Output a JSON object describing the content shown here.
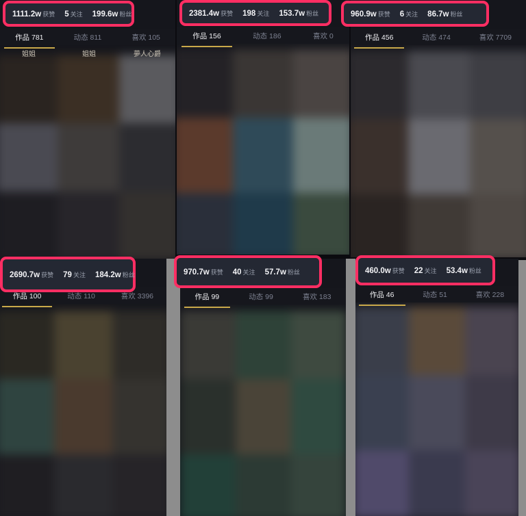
{
  "panels": [
    {
      "id": "p1",
      "stats": [
        {
          "num": "1111.2w",
          "lbl": "获赞"
        },
        {
          "num": "5",
          "lbl": "关注"
        },
        {
          "num": "199.6w",
          "lbl": "粉丝"
        }
      ],
      "tabs": [
        {
          "label": "作品 781",
          "active": true
        },
        {
          "label": "动态 811"
        },
        {
          "label": "喜欢 105"
        }
      ],
      "thumb_titles": [
        "姐姐",
        "姐姐",
        "夢人心爵"
      ]
    },
    {
      "id": "p2",
      "stats": [
        {
          "num": "2381.4w",
          "lbl": "获赞"
        },
        {
          "num": "198",
          "lbl": "关注"
        },
        {
          "num": "153.7w",
          "lbl": "粉丝"
        }
      ],
      "tabs": [
        {
          "label": "作品 156",
          "active": true
        },
        {
          "label": "动态 186"
        },
        {
          "label": "喜欢 0"
        }
      ]
    },
    {
      "id": "p3",
      "stats": [
        {
          "num": "960.9w",
          "lbl": "获赞"
        },
        {
          "num": "6",
          "lbl": "关注"
        },
        {
          "num": "86.7w",
          "lbl": "粉丝"
        }
      ],
      "tabs": [
        {
          "label": "作品 456",
          "active": true
        },
        {
          "label": "动态 474"
        },
        {
          "label": "喜欢 7709"
        }
      ]
    },
    {
      "id": "p4",
      "stats": [
        {
          "num": "2690.7w",
          "lbl": "获赞"
        },
        {
          "num": "79",
          "lbl": "关注"
        },
        {
          "num": "184.2w",
          "lbl": "粉丝"
        }
      ],
      "tabs": [
        {
          "label": "作品 100",
          "active": true
        },
        {
          "label": "动态 110"
        },
        {
          "label": "喜欢 3396"
        }
      ]
    },
    {
      "id": "p5",
      "stats": [
        {
          "num": "970.7w",
          "lbl": "获赞"
        },
        {
          "num": "40",
          "lbl": "关注"
        },
        {
          "num": "57.7w",
          "lbl": "粉丝"
        }
      ],
      "tabs": [
        {
          "label": "作品 99",
          "active": true
        },
        {
          "label": "动态 99"
        },
        {
          "label": "喜欢 183"
        }
      ]
    },
    {
      "id": "p6",
      "stats": [
        {
          "num": "460.0w",
          "lbl": "获赞"
        },
        {
          "num": "22",
          "lbl": "关注"
        },
        {
          "num": "53.4w",
          "lbl": "粉丝"
        }
      ],
      "tabs": [
        {
          "label": "作品 46",
          "active": true
        },
        {
          "label": "动态 51"
        },
        {
          "label": "喜欢 228"
        }
      ]
    }
  ],
  "colors": {
    "highlight": "#ff2e63",
    "tab_underline": "#c9a94a",
    "background": "#0b0b0f"
  }
}
